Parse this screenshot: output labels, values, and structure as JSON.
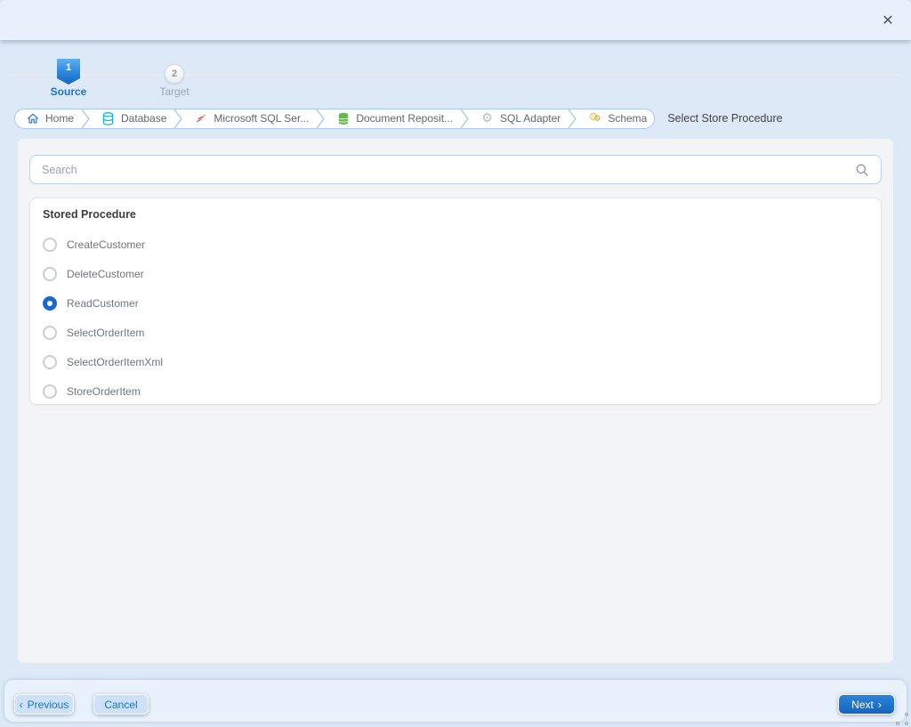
{
  "window": {
    "close_glyph": "✕"
  },
  "stepper": {
    "steps": [
      {
        "number": "1",
        "label": "Source",
        "active": true
      },
      {
        "number": "2",
        "label": "Target",
        "active": false
      }
    ]
  },
  "breadcrumb": {
    "items": [
      {
        "label": "Home",
        "icon": "home-icon"
      },
      {
        "label": "Database",
        "icon": "database-icon"
      },
      {
        "label": "Microsoft SQL Ser...",
        "icon": "sql-server-flag-icon"
      },
      {
        "label": "Document Reposit...",
        "icon": "document-repository-icon"
      },
      {
        "label": "SQL Adapter",
        "icon": "gear-icon"
      },
      {
        "label": "Schema",
        "icon": "schema-gears-icon"
      }
    ],
    "current": "Select Store Procedure"
  },
  "search": {
    "placeholder": "Search",
    "value": "",
    "icon": "search-icon"
  },
  "procedures": {
    "title": "Stored Procedure",
    "items": [
      {
        "label": "CreateCustomer",
        "selected": false
      },
      {
        "label": "DeleteCustomer",
        "selected": false
      },
      {
        "label": "ReadCustomer",
        "selected": true
      },
      {
        "label": "SelectOrderItem",
        "selected": false
      },
      {
        "label": "SelectOrderItemXml",
        "selected": false
      },
      {
        "label": "StoreOrderItem",
        "selected": false
      }
    ]
  },
  "footer": {
    "previous_label": "Previous",
    "previous_chevron": "‹",
    "cancel_label": "Cancel",
    "next_label": "Next",
    "next_chevron": "›"
  },
  "colors": {
    "accent_blue": "#1a73d2",
    "selected_radio": "#1669cf",
    "page_bg": "#dde9f7",
    "bar_bg": "#e7f0fb",
    "panel_bg": "#ffffff",
    "main_bg": "#f3f4f6"
  }
}
